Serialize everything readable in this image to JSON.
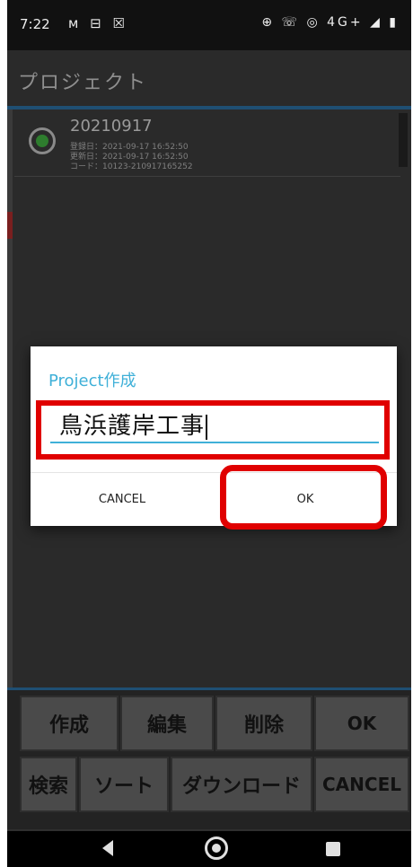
{
  "status_bar": {
    "time": "7:22",
    "left_icons": "ᴍ ⊟ ☒",
    "right_icons": "⊕ ☏ ◎ 4G+ ◢ ▮"
  },
  "app": {
    "title": "プロジェクト",
    "project_item": {
      "name": "20210917",
      "registered": "登録日：2021-09-17 16:52:50",
      "updated": "更新日：2021-09-17 16:52:50",
      "code": "コード：10123-210917165252",
      "selected": true
    }
  },
  "buttons": {
    "create": "作成",
    "edit": "編集",
    "delete": "削除",
    "ok": "OK",
    "search": "検索",
    "sort": "ソート",
    "download": "ダウンロード",
    "cancel": "CANCEL"
  },
  "dialog": {
    "title": "Project作成",
    "input_value": "鳥浜護岸工事",
    "cancel_label": "CANCEL",
    "ok_label": "OK"
  },
  "colors": {
    "accent": "#3fb0d8",
    "highlight": "#e00000",
    "radio_selected": "#2e7d2e"
  }
}
